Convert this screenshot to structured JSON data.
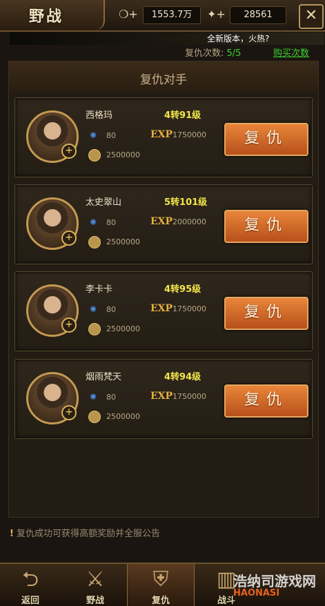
{
  "header": {
    "title": "野战",
    "silver_amount": "1553.7万",
    "gold_amount": "28561",
    "notice": "全新版本，火热?",
    "revenge_label": "复仇次数:",
    "revenge_value": "5/5",
    "buy_label": "购买次数"
  },
  "panel": {
    "title": "复仇对手"
  },
  "opponents": [
    {
      "name": "西格玛",
      "level": "4转91级",
      "power": "80",
      "exp_label": "EXP",
      "exp": "1750000",
      "gold": "2500000",
      "button": "复仇"
    },
    {
      "name": "太史翠山",
      "level": "5转101级",
      "power": "80",
      "exp_label": "EXP",
      "exp": "2000000",
      "gold": "2500000",
      "button": "复仇"
    },
    {
      "name": "李卡卡",
      "level": "4转95级",
      "power": "80",
      "exp_label": "EXP",
      "exp": "1750000",
      "gold": "2500000",
      "button": "复仇"
    },
    {
      "name": "烟雨梵天",
      "level": "4转94级",
      "power": "80",
      "exp_label": "EXP",
      "exp": "1750000",
      "gold": "2500000",
      "button": "复仇"
    }
  ],
  "hint": "复仇成功可获得高额奖励并全服公告",
  "bottom_nav": [
    {
      "label": "返回",
      "icon": "back-arrow-icon"
    },
    {
      "label": "野战",
      "icon": "crossed-swords-icon"
    },
    {
      "label": "复仇",
      "icon": "revenge-helmet-icon"
    },
    {
      "label": "战斗",
      "icon": "battle-book-icon"
    }
  ],
  "watermark": {
    "text1": "浩纳司游戏网",
    "text2": "HAONASI"
  },
  "colors": {
    "accent_green": "#3ecf2e",
    "level_yellow": "#f3e64a",
    "button_orange": "#d06a2a"
  }
}
